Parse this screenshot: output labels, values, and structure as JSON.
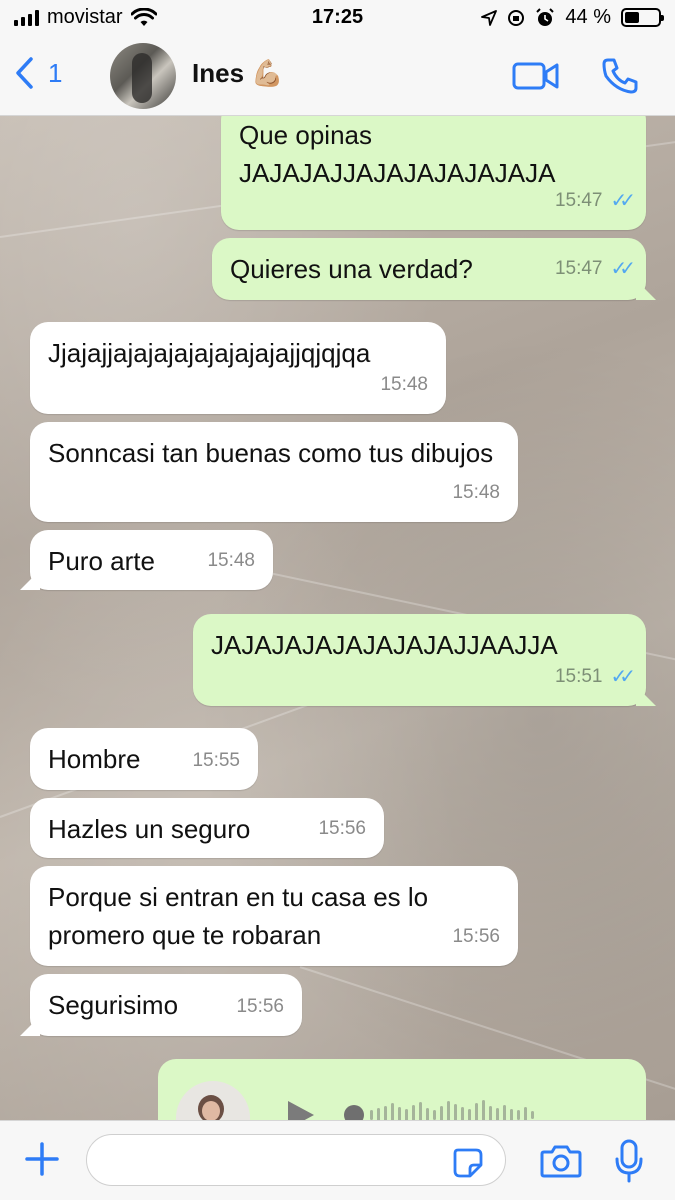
{
  "status_bar": {
    "carrier": "movistar",
    "time": "17:25",
    "battery_percent": "44 %",
    "battery_level": 0.44
  },
  "header": {
    "back_count": "1",
    "contact_name": "Ines",
    "contact_emoji": "💪🏼",
    "icons": [
      "back-chevron-icon",
      "video-call-icon",
      "phone-icon"
    ]
  },
  "messages": [
    {
      "direction": "out",
      "text": "Que opinas JAJAJAJJAJAJAJAJAJAJA",
      "time": "15:47",
      "read": true
    },
    {
      "direction": "out",
      "text": "Quieres una verdad?",
      "time": "15:47",
      "read": true
    },
    {
      "direction": "in",
      "text": "Jjajajjajajajajajajajajajjqjqjqa",
      "time": "15:48"
    },
    {
      "direction": "in",
      "text": "Sonncasi tan buenas como tus dibujos",
      "time": "15:48"
    },
    {
      "direction": "in",
      "text": "Puro arte",
      "time": "15:48"
    },
    {
      "direction": "out",
      "text": "JAJAJAJAJAJAJAJAJJAAJJA",
      "time": "15:51",
      "read": true
    },
    {
      "direction": "in",
      "text": "Hombre",
      "time": "15:55"
    },
    {
      "direction": "in",
      "text": "Hazles un seguro",
      "time": "15:56"
    },
    {
      "direction": "in",
      "text": "Porque si entran en tu casa es lo promero que te robaran",
      "time": "15:56"
    },
    {
      "direction": "in",
      "text": "Segurisimo",
      "time": "15:56"
    }
  ],
  "voice_note": {
    "direction": "out",
    "icons": [
      "play-icon"
    ]
  },
  "input_bar": {
    "placeholder": "",
    "icons": [
      "plus-icon",
      "sticker-icon",
      "camera-icon",
      "microphone-icon"
    ]
  },
  "colors": {
    "accent": "#2e7cf6",
    "outgoing_bubble": "#dbf8c6",
    "incoming_bubble": "#ffffff",
    "read_ticks": "#53a8f0"
  }
}
